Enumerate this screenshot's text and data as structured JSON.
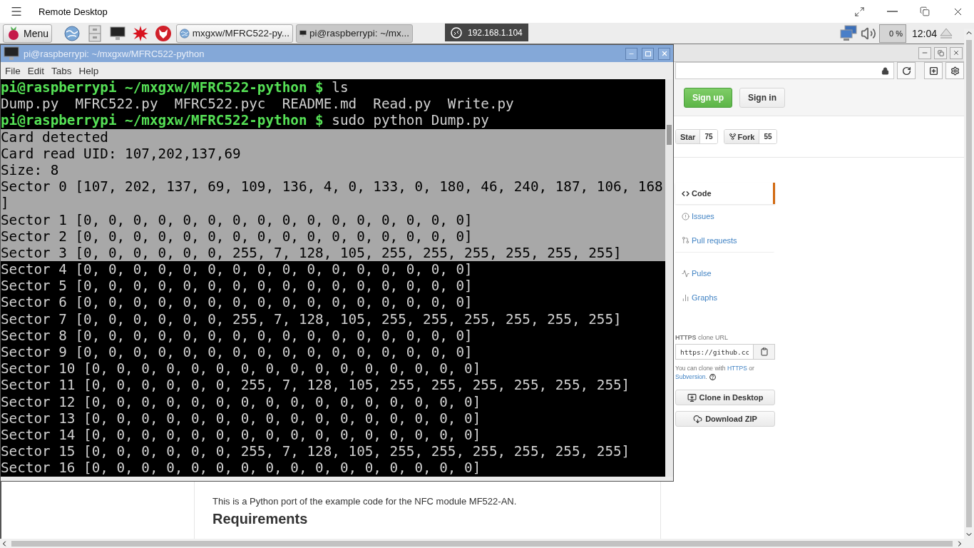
{
  "app": {
    "title": "Remote Desktop"
  },
  "taskbar": {
    "menu_label": "Menu",
    "tasks": [
      {
        "label": "mxgxw/MFRC522-py...",
        "kind": "browser",
        "selected": false
      },
      {
        "label": "pi@raspberrypi: ~/mx...",
        "kind": "terminal",
        "selected": true
      }
    ],
    "cpu": "0 %",
    "clock": "12:04"
  },
  "connection": {
    "address": "192.168.1.104"
  },
  "terminal": {
    "title": "pi@raspberrypi: ~/mxgxw/MFRC522-python",
    "menu": [
      "File",
      "Edit",
      "Tabs",
      "Help"
    ],
    "lines": [
      {
        "kind": "prompt",
        "prompt": "pi@raspberrypi ~/mxgxw/MFRC522-python $",
        "command": "ls",
        "selected": false
      },
      {
        "kind": "output",
        "text": "Dump.py  MFRC522.py  MFRC522.pyc  README.md  Read.py  Write.py",
        "selected": false
      },
      {
        "kind": "prompt",
        "prompt": "pi@raspberrypi ~/mxgxw/MFRC522-python $",
        "command": "sudo python Dump.py",
        "selected": false
      },
      {
        "kind": "output",
        "text": "Card detected",
        "selected": true
      },
      {
        "kind": "output",
        "text": "Card read UID: 107,202,137,69",
        "selected": true
      },
      {
        "kind": "output",
        "text": "Size: 8",
        "selected": true
      },
      {
        "kind": "output",
        "text": "Sector 0 [107, 202, 137, 69, 109, 136, 4, 0, 133, 0, 180, 46, 240, 187, 106, 168",
        "selected": true
      },
      {
        "kind": "output",
        "text": "]",
        "selected": true
      },
      {
        "kind": "output",
        "text": "Sector 1 [0, 0, 0, 0, 0, 0, 0, 0, 0, 0, 0, 0, 0, 0, 0, 0]",
        "selected": true
      },
      {
        "kind": "output",
        "text": "Sector 2 [0, 0, 0, 0, 0, 0, 0, 0, 0, 0, 0, 0, 0, 0, 0, 0]",
        "selected": true
      },
      {
        "kind": "output",
        "text": "Sector 3 [0, 0, 0, 0, 0, 0, 255, 7, 128, 105, 255, 255, 255, 255, 255, 255]",
        "selected": true
      },
      {
        "kind": "output",
        "text": "Sector 4 [0, 0, 0, 0, 0, 0, 0, 0, 0, 0, 0, 0, 0, 0, 0, 0]",
        "selected": false
      },
      {
        "kind": "output",
        "text": "Sector 5 [0, 0, 0, 0, 0, 0, 0, 0, 0, 0, 0, 0, 0, 0, 0, 0]",
        "selected": false
      },
      {
        "kind": "output",
        "text": "Sector 6 [0, 0, 0, 0, 0, 0, 0, 0, 0, 0, 0, 0, 0, 0, 0, 0]",
        "selected": false
      },
      {
        "kind": "output",
        "text": "Sector 7 [0, 0, 0, 0, 0, 0, 255, 7, 128, 105, 255, 255, 255, 255, 255, 255]",
        "selected": false
      },
      {
        "kind": "output",
        "text": "Sector 8 [0, 0, 0, 0, 0, 0, 0, 0, 0, 0, 0, 0, 0, 0, 0, 0]",
        "selected": false
      },
      {
        "kind": "output",
        "text": "Sector 9 [0, 0, 0, 0, 0, 0, 0, 0, 0, 0, 0, 0, 0, 0, 0, 0]",
        "selected": false
      },
      {
        "kind": "output",
        "text": "Sector 10 [0, 0, 0, 0, 0, 0, 0, 0, 0, 0, 0, 0, 0, 0, 0, 0]",
        "selected": false
      },
      {
        "kind": "output",
        "text": "Sector 11 [0, 0, 0, 0, 0, 0, 255, 7, 128, 105, 255, 255, 255, 255, 255, 255]",
        "selected": false
      },
      {
        "kind": "output",
        "text": "Sector 12 [0, 0, 0, 0, 0, 0, 0, 0, 0, 0, 0, 0, 0, 0, 0, 0]",
        "selected": false
      },
      {
        "kind": "output",
        "text": "Sector 13 [0, 0, 0, 0, 0, 0, 0, 0, 0, 0, 0, 0, 0, 0, 0, 0]",
        "selected": false
      },
      {
        "kind": "output",
        "text": "Sector 14 [0, 0, 0, 0, 0, 0, 0, 0, 0, 0, 0, 0, 0, 0, 0, 0]",
        "selected": false
      },
      {
        "kind": "output",
        "text": "Sector 15 [0, 0, 0, 0, 0, 0, 255, 7, 128, 105, 255, 255, 255, 255, 255, 255]",
        "selected": false
      },
      {
        "kind": "output",
        "text": "Sector 16 [0, 0, 0, 0, 0, 0, 0, 0, 0, 0, 0, 0, 0, 0, 0, 0]",
        "selected": false
      }
    ]
  },
  "browser": {
    "account_buttons": [
      {
        "label": "Sign up",
        "kind": "primary"
      },
      {
        "label": "Sign in",
        "kind": "default"
      }
    ],
    "repo_actions": [
      {
        "label": "Star",
        "count": "75",
        "kind": "star"
      },
      {
        "label": "Fork",
        "count": "55",
        "kind": "fork"
      }
    ],
    "nav": [
      {
        "label": "Code",
        "kind": "code",
        "selected": true
      },
      {
        "label": "Issues",
        "kind": "issues",
        "selected": false
      },
      {
        "label": "Pull requests",
        "kind": "pulls",
        "selected": false
      },
      {
        "label": "Pulse",
        "kind": "pulse",
        "selected": false
      },
      {
        "label": "Graphs",
        "kind": "graphs",
        "selected": false
      }
    ],
    "clone": {
      "title": "**HTTPS** clone URL",
      "url": "https://github.cc",
      "note": [
        {
          "kind": "text",
          "text": "You can clone with "
        },
        {
          "kind": "link",
          "text": "HTTPS"
        },
        {
          "kind": "text",
          "text": " or "
        },
        {
          "kind": "link",
          "text": "Subversion"
        },
        {
          "kind": "text",
          "text": "."
        }
      ]
    },
    "downloads": [
      {
        "label": "Clone in Desktop",
        "kind": "desktop"
      },
      {
        "label": "Download ZIP",
        "kind": "zip"
      }
    ],
    "readme": {
      "text": "This is a Python port of the example code for the NFC module MF522-AN.",
      "heading": "Requirements"
    }
  }
}
